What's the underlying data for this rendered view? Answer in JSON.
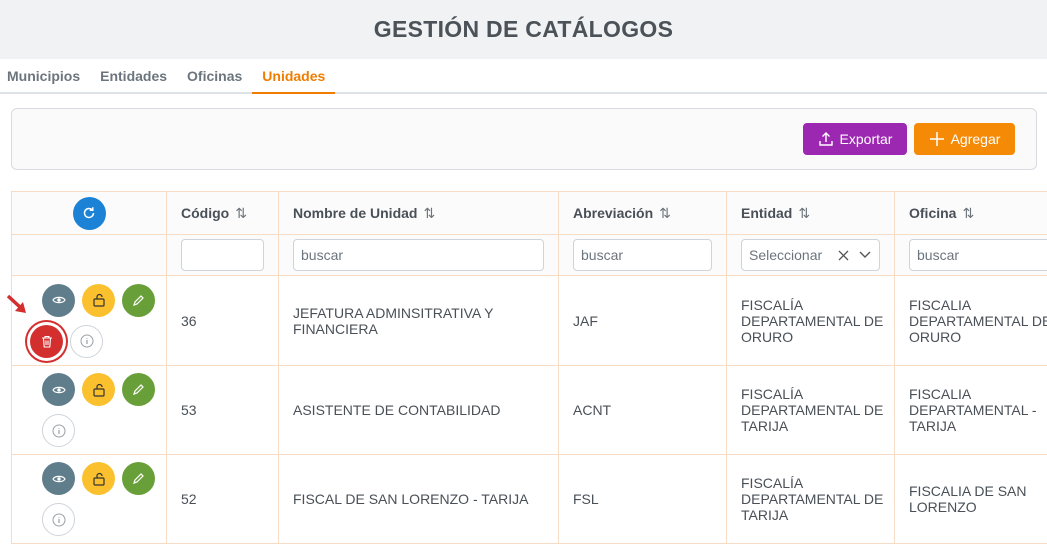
{
  "page": {
    "title": "GESTIÓN DE CATÁLOGOS"
  },
  "tabs": [
    {
      "label": "Municipios",
      "active": false
    },
    {
      "label": "Entidades",
      "active": false
    },
    {
      "label": "Oficinas",
      "active": false
    },
    {
      "label": "Unidades",
      "active": true
    }
  ],
  "toolbar": {
    "export_label": "Exportar",
    "add_label": "Agregar"
  },
  "table": {
    "columns": [
      "Código",
      "Nombre de Unidad",
      "Abreviación",
      "Entidad",
      "Oficina"
    ],
    "filters": {
      "placeholder": "buscar",
      "select_placeholder": "Seleccionar"
    },
    "rows": [
      {
        "codigo": "36",
        "nombre": "JEFATURA ADMINSITRATIVA Y FINANCIERA",
        "abreviacion": "JAF",
        "entidad": "FISCALÍA DEPARTAMENTAL DE ORURO",
        "oficina": "FISCALIA DEPARTAMENTAL DE ORURO"
      },
      {
        "codigo": "53",
        "nombre": "ASISTENTE DE CONTABILIDAD",
        "abreviacion": "ACNT",
        "entidad": "FISCALÍA DEPARTAMENTAL DE TARIJA",
        "oficina": "FISCALIA DEPARTAMENTAL - TARIJA"
      },
      {
        "codigo": "52",
        "nombre": "FISCAL DE SAN LORENZO - TARIJA",
        "abreviacion": "FSL",
        "entidad": "FISCALÍA DEPARTAMENTAL DE TARIJA",
        "oficina": "FISCALIA DE SAN LORENZO"
      }
    ]
  },
  "colors": {
    "accent": "#f07d00",
    "export": "#9c27b0",
    "add": "#f58a07",
    "refresh": "#1b82d6",
    "view": "#607d8b",
    "unlock": "#fbc02d",
    "edit": "#689f38",
    "delete": "#d32f2f"
  },
  "icons": [
    "refresh-icon",
    "upload-icon",
    "plus-icon",
    "sort-icon",
    "clear-icon",
    "chevron-down-icon",
    "eye-icon",
    "unlock-icon",
    "pencil-icon",
    "trash-icon",
    "info-icon",
    "red-arrow-indicator"
  ]
}
